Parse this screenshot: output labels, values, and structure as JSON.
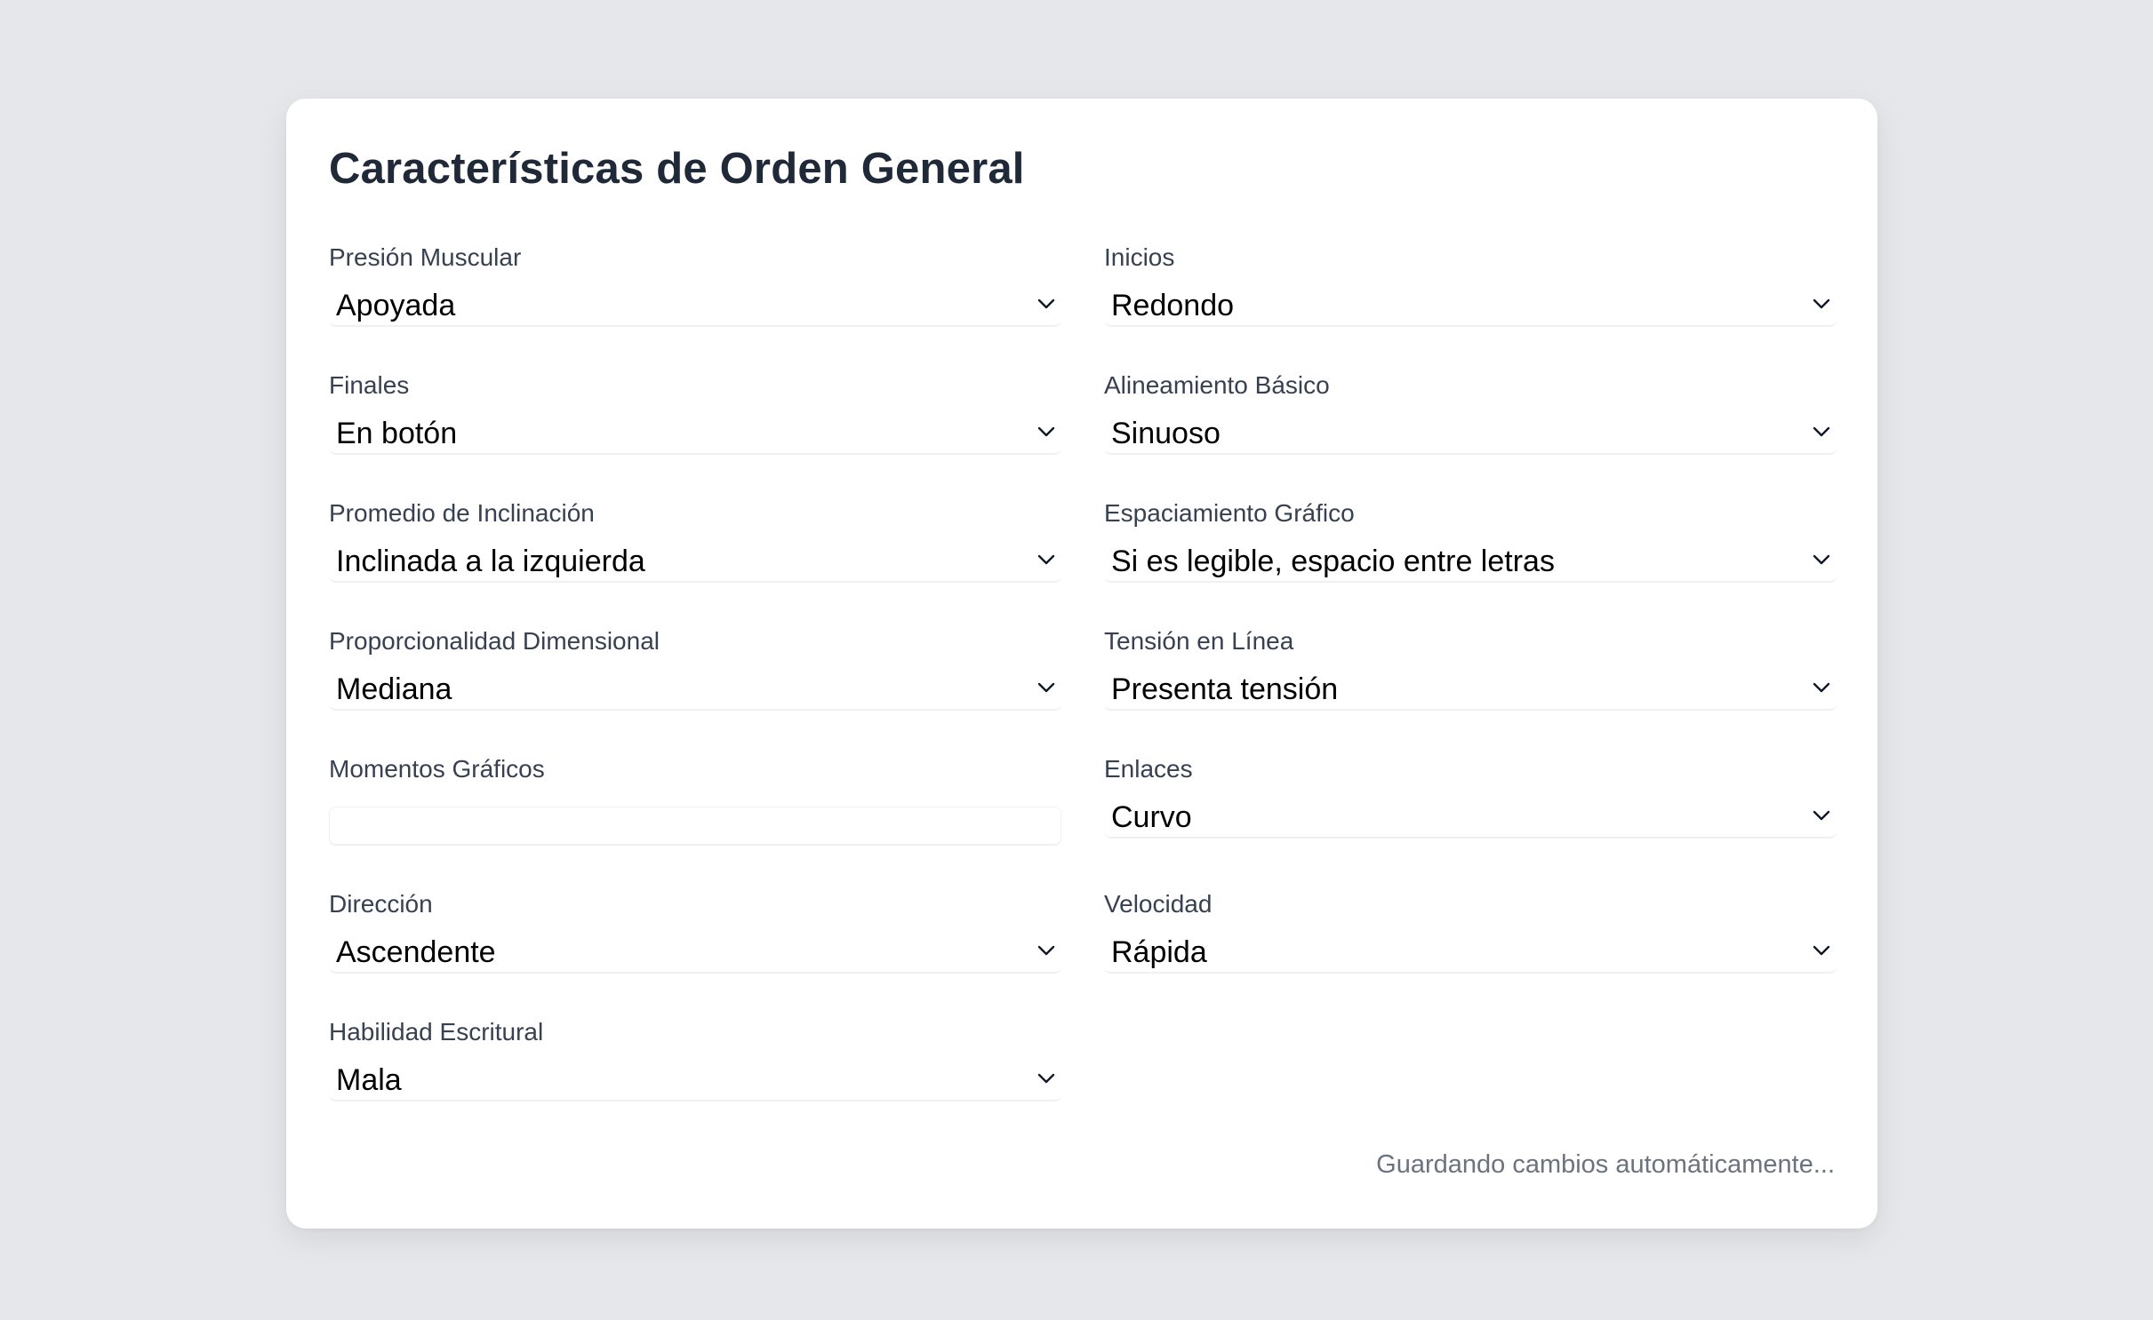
{
  "form": {
    "title": "Características de Orden General",
    "fields": [
      {
        "label": "Presión Muscular",
        "value": "Apoyada"
      },
      {
        "label": "Inicios",
        "value": "Redondo"
      },
      {
        "label": "Finales",
        "value": "En botón"
      },
      {
        "label": "Alineamiento Básico",
        "value": "Sinuoso"
      },
      {
        "label": "Promedio de Inclinación",
        "value": "Inclinada a la izquierda"
      },
      {
        "label": "Espaciamiento Gráfico",
        "value": "Si es legible, espacio entre letras"
      },
      {
        "label": "Proporcionalidad Dimensional",
        "value": "Mediana"
      },
      {
        "label": "Tensión en Línea",
        "value": "Presenta tensión"
      },
      {
        "label": "Momentos Gráficos",
        "value": ""
      },
      {
        "label": "Enlaces",
        "value": "Curvo"
      },
      {
        "label": "Dirección",
        "value": "Ascendente"
      },
      {
        "label": "Velocidad",
        "value": "Rápida"
      },
      {
        "label": "Habilidad Escritural",
        "value": "Mala"
      }
    ],
    "status": "Guardando cambios automáticamente..."
  },
  "colors": {
    "background": "#e5e7eb",
    "card": "#ffffff",
    "title": "#1f2937",
    "label": "#374151",
    "status": "#6b7280"
  }
}
